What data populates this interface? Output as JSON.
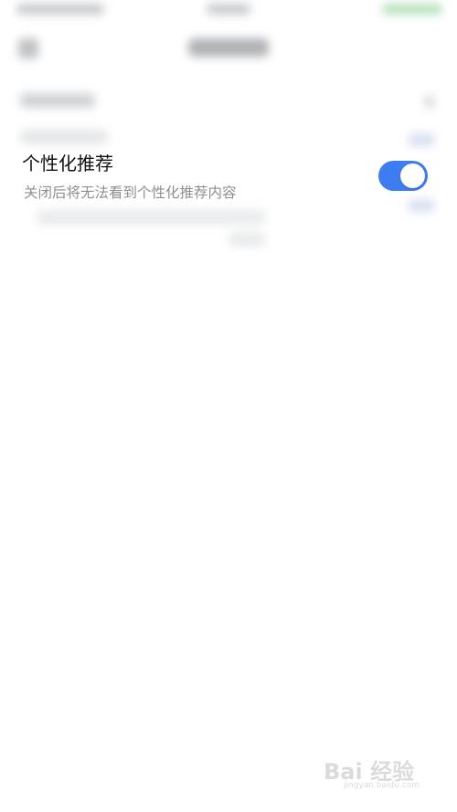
{
  "setting": {
    "title": "个性化推荐",
    "description": "关闭后将无法看到个性化推荐内容",
    "toggle_state": "on",
    "toggle_color": "#3e7cf2"
  },
  "watermark": {
    "logo_text": "Bai 经验",
    "url": "jingyan.baidu.com"
  }
}
